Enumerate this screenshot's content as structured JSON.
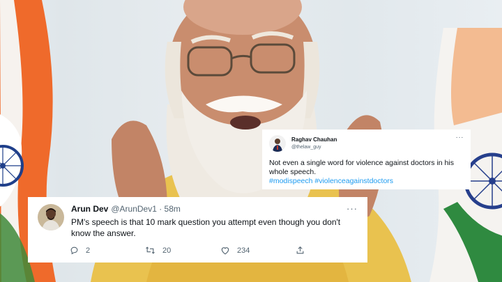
{
  "tweet_top": {
    "author_name": "Raghav Chauhan",
    "author_handle": "@thelaw_guy",
    "more_icon": "more-horizontal-icon",
    "text": "Not even a single word for violence against doctors in his whole speech.",
    "hashtags": "#modispeech #violenceagainstdoctors",
    "hashtag_color": "#1d9bf0"
  },
  "tweet_bottom": {
    "author_name": "Arun Dev",
    "author_meta": "@ArunDev1 · 58m",
    "more_icon": "more-horizontal-icon",
    "text": "PM's speech is that 10 mark question you attempt even though you don't know the answer.",
    "reply_count": "2",
    "retweet_count": "20",
    "like_count": "234",
    "icons": [
      "reply-icon",
      "retweet-icon",
      "like-icon",
      "share-icon"
    ]
  }
}
